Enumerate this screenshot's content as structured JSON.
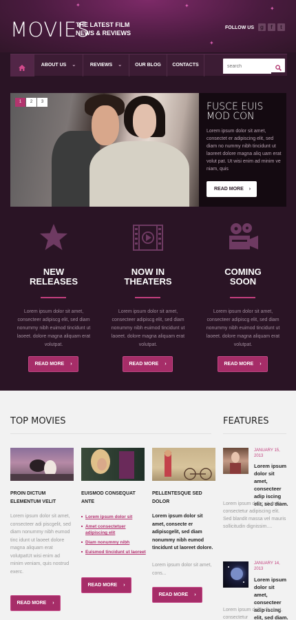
{
  "header": {
    "logo": "MOVIES",
    "tagline_1": "THE LATEST FILM",
    "tagline_2": "NEWS & REVIEWS",
    "follow": "FOLLOW US",
    "social": [
      "g",
      "f",
      "t"
    ]
  },
  "nav": {
    "items": [
      "ABOUT US",
      "REVIEWS",
      "OUR BLOG",
      "CONTACTS"
    ],
    "search_placeholder": "search"
  },
  "hero": {
    "pages": [
      "1",
      "2",
      "3"
    ],
    "title": "FUSCE EUIS MOD CON",
    "text": "Lorem ipsum dolor sit amet, consectet er adipiscing elit, sed diam no nummy nibh tincidunt ut laoreet dolore magna aliq uam erat volut pat. Ut wisi enim ad minim ve niam, quis",
    "button": "READ MORE"
  },
  "columns": [
    {
      "title_1": "NEW",
      "title_2": "RELEASES",
      "icon": "star-icon",
      "text": "Lorem ipsum dolor sit amet, consecteer adipiscg elit, sed diam nonummy nibh euimod tincidunt ut laoeet. dolore magna aliquam erat volutpat.",
      "button": "READ MORE"
    },
    {
      "title_1": "NOW IN",
      "title_2": "THEATERS",
      "icon": "film-play-icon",
      "text": "Lorem ipsum dolor sit amet, consecteer adipiscg elit, sed diam nonummy nibh euimod tincidunt ut laoeet. dolore magna aliquam erat volutpat.",
      "button": "READ MORE"
    },
    {
      "title_1": "COMING",
      "title_2": "SOON",
      "icon": "projector-icon",
      "text": "Lorem ipsum dolor sit amet, consecteer adipiscg elit, sed diam nonummy nibh euimod tincidunt ut laoeet. dolore magna aliquam erat volutpat.",
      "button": "READ MORE"
    }
  ],
  "top_movies": {
    "heading": "TOP MOVIES",
    "items": [
      {
        "title": "PROIN DICTUM ELEMENTUM VELIT",
        "text": "Lorem ipsum dolor sit amet, consecteer adi piscgelit, sed diam nonummy nibh eumod tinc idunt ut laoeet dolore magna aliquam erat volutpatUt wisi enim ad minim veniam, quis nostrud exerc.",
        "button": "READ MORE"
      },
      {
        "title": "EUISMOD CONSEQUAT ANTE",
        "links": [
          "Lorem ipsum dolor sit",
          "Amet consectetuer adipiscing elit",
          "Diam nonummy nibh",
          "Euismod tincidunt ut laoreet"
        ],
        "button": "READ MORE"
      },
      {
        "title": "PELLENTESQUE SED DOLOR",
        "text": "Lorem ipsum dolor sit amet, consecte er adipiscgelit, sed diam nonummy nibh eumod tincidunt ut laoreet dolore.",
        "text2": "Lorem ipsum dolor sit amet, cons...",
        "button": "READ MORE"
      }
    ]
  },
  "features": {
    "heading": "FEATURES",
    "items": [
      {
        "date_1": "JANUARY 15,",
        "date_2": "2013",
        "text": "Lorem ipsum dolor sit amet, consecteer adip iscing elit, sed diam.",
        "gray": "Lorem ipsum dolor sit amet, consectetur adipiscing elit. Sed blandit massa vel mauris sollicitudin dignissim...."
      },
      {
        "date_1": "JANUARY 14,",
        "date_2": "2013",
        "text": "Lorem ipsum dolor sit amet, consecteer adip iscing elit, sed diam.",
        "gray": "Lorem ipsum dolor sit amet, consectetur"
      }
    ]
  },
  "colors": {
    "accent": "#b2356e",
    "bg_dark": "#2a1425",
    "bg_light": "#f2f2f2"
  }
}
